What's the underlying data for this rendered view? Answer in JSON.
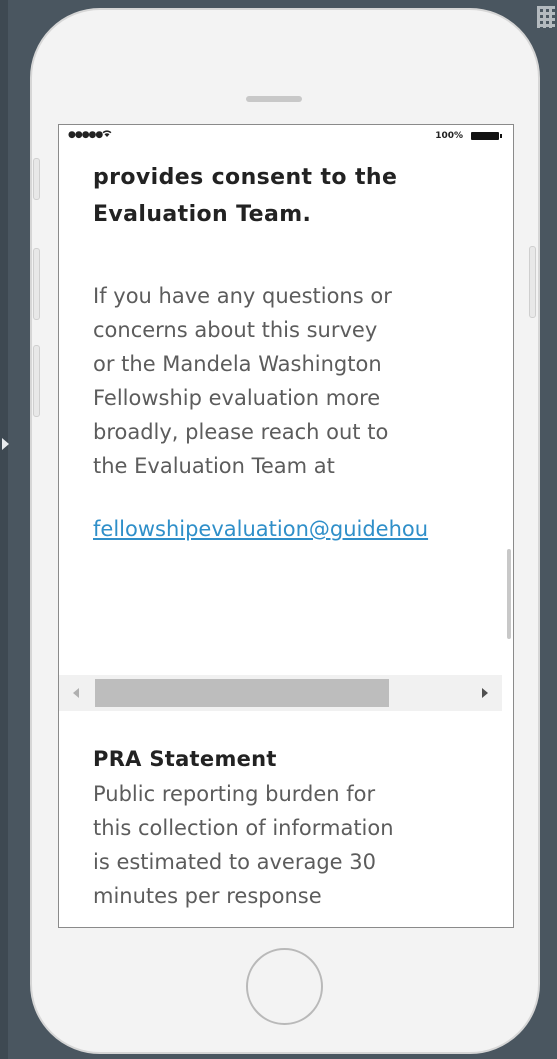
{
  "status_bar": {
    "signal": "●●●●● ",
    "wifi_icon": "wifi-icon",
    "battery_text": "100%"
  },
  "consent": {
    "heading_lines": [
      "provides consent to the",
      "Evaluation Team."
    ],
    "paragraph_lines": [
      "If you have any questions or",
      "concerns about this survey",
      "or the Mandela Washington",
      "Fellowship evaluation more",
      "broadly, please reach out to",
      "the Evaluation Team at"
    ],
    "email": "fellowshipevaluation@guidehou"
  },
  "pra": {
    "heading": "PRA Statement",
    "lines": [
      "Public reporting burden for",
      "this collection of information",
      "is estimated to average 30",
      "minutes per response"
    ]
  },
  "colors": {
    "background": "#4a5660",
    "link": "#2f8fc9",
    "text": "#5c5c5c",
    "heading": "#222222"
  }
}
